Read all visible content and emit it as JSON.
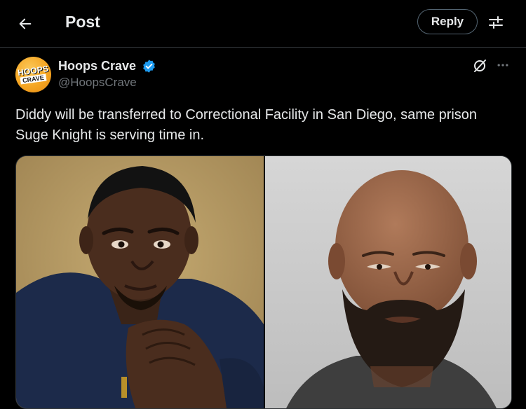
{
  "header": {
    "title": "Post",
    "reply_label": "Reply",
    "back_icon": "arrow-left-icon",
    "settings_icon": "sliders-icon"
  },
  "post": {
    "author": {
      "name": "Hoops Crave",
      "handle": "@HoopsCrave",
      "verified": true,
      "avatar_text": [
        "HOOPS",
        "CRAVE"
      ]
    },
    "text": "Diddy will be transferred to Correctional Facility in San Diego, same prison Suge Knight is serving time in.",
    "media": [
      {
        "kind": "photo",
        "subject": "man in navy sweater with clasped hands"
      },
      {
        "kind": "photo",
        "subject": "bald bearded man mugshot"
      }
    ]
  },
  "colors": {
    "background": "#000000",
    "text": "#e7e9ea",
    "muted": "#71767b",
    "border": "#2f3336",
    "verified": "#1d9bf0",
    "avatar": "#f5a623"
  }
}
